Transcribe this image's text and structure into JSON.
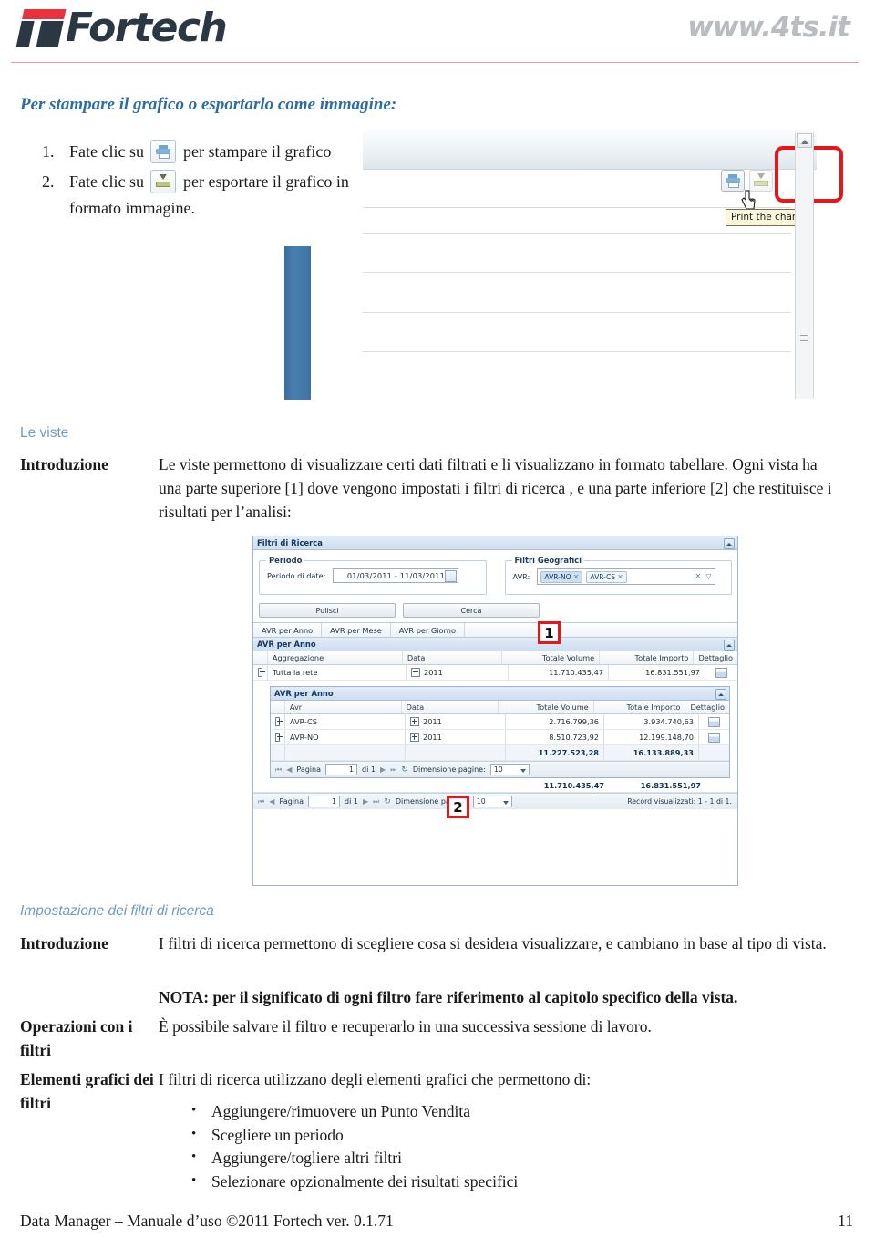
{
  "header": {
    "logo_text": "Fortech",
    "site_url": "www.4ts.it"
  },
  "sections": {
    "print_export": {
      "title": "Per stampare il grafico o esportarlo come immagine:",
      "steps": [
        {
          "num": "1.",
          "before": "Fate clic su",
          "icon": "printer-icon",
          "after": "per stampare il grafico"
        },
        {
          "num": "2.",
          "before": "Fate clic su",
          "icon": "export-image-icon",
          "after": "per esportare il grafico in formato immagine."
        }
      ]
    },
    "le_viste": {
      "title": "Le viste",
      "term": "Introduzione",
      "paragraph": "Le viste permettono di visualizzare certi dati filtrati e li visualizzano in formato tabellare. Ogni vista ha una parte superiore [1] dove vengono impostati i filtri di ricerca , e una parte inferiore [2] che restituisce i risultati per l’analisi:"
    },
    "impostazione_filtri": {
      "title": "Impostazione dei filtri di ricerca",
      "intro_term": "Introduzione",
      "intro_text": "I filtri di ricerca permettono di scegliere cosa si desidera visualizzare, e cambiano in base al tipo di vista.",
      "note_text": "NOTA: per il significato di ogni filtro fare riferimento al capitolo specifico della vista.",
      "operazioni_term": "Operazioni con i filtri",
      "operazioni_text": "È possibile salvare il filtro e recuperarlo in una successiva sessione di lavoro.",
      "elementi_term": "Elementi grafici dei filtri",
      "elementi_text": "I filtri di ricerca utilizzano degli elementi grafici che permettono di:",
      "bullets": [
        "Aggiungere/rimuovere un Punto Vendita",
        "Scegliere un periodo",
        "Aggiungere/togliere altri filtri",
        "Selezionare opzionalmente dei risultati specifici"
      ]
    }
  },
  "chart_screenshot": {
    "tooltip": "Print the chart",
    "print_button_name": "print-chart-button",
    "export_button_name": "export-chart-button",
    "callout_label": ""
  },
  "view_screenshot": {
    "filters_panel_title": "Filtri di Ricerca",
    "periodo_legend": "Periodo",
    "periodo_label": "Periodo di date:",
    "periodo_value": "01/03/2011  -  11/03/2011",
    "geo_legend": "Filtri Geografici",
    "geo_label": "AVR:",
    "geo_tags": [
      {
        "label": "AVR-NO",
        "selected": true
      },
      {
        "label": "AVR-CS",
        "selected": false
      }
    ],
    "btn_clear": "Pulisci",
    "btn_search": "Cerca",
    "callout_1": "1",
    "callout_2": "2",
    "tabs": [
      "AVR per Anno",
      "AVR per Mese",
      "AVR per Giorno"
    ],
    "outer_panel_title": "AVR per Anno",
    "outer_columns": [
      "Aggregazione",
      "Data",
      "Totale Volume",
      "Totale Importo",
      "Dettaglio"
    ],
    "outer_row": {
      "aggregazione": "Tutta la rete",
      "data": "2011",
      "totale_volume": "11.710.435,47",
      "totale_importo": "16.831.551,97"
    },
    "inner_panel_title": "AVR per Anno",
    "inner_columns": [
      "Avr",
      "Data",
      "Totale Volume",
      "Totale Importo",
      "Dettaglio"
    ],
    "inner_rows": [
      {
        "avr": "AVR-CS",
        "data": "2011",
        "totale_volume": "2.716.799,36",
        "totale_importo": "3.934.740,63"
      },
      {
        "avr": "AVR-NO",
        "data": "2011",
        "totale_volume": "8.510.723,92",
        "totale_importo": "12.199.148,70"
      }
    ],
    "inner_totals": {
      "totale_volume": "11.227.523,28",
      "totale_importo": "16.133.889,33"
    },
    "outer_totals": {
      "totale_volume": "11.710.435,47",
      "totale_importo": "16.831.551,97"
    },
    "pager": {
      "page_label": "Pagina",
      "page_value": "1",
      "of_label": "di 1",
      "size_label": "Dimensione pagine:",
      "size_value": "10",
      "records_label": "Record visualizzati: 1 - 1 di 1."
    }
  },
  "footer": {
    "text": "Data Manager – Manuale d’uso ©2011 Fortech ver. 0.1.71",
    "page": "11"
  },
  "colors": {
    "brand_red": "#e8323c",
    "brand_dark": "#2b3844",
    "heading_blue": "#6b9bc8",
    "callout_red": "#e8161b",
    "bar_blue": "#4a7fb1"
  }
}
